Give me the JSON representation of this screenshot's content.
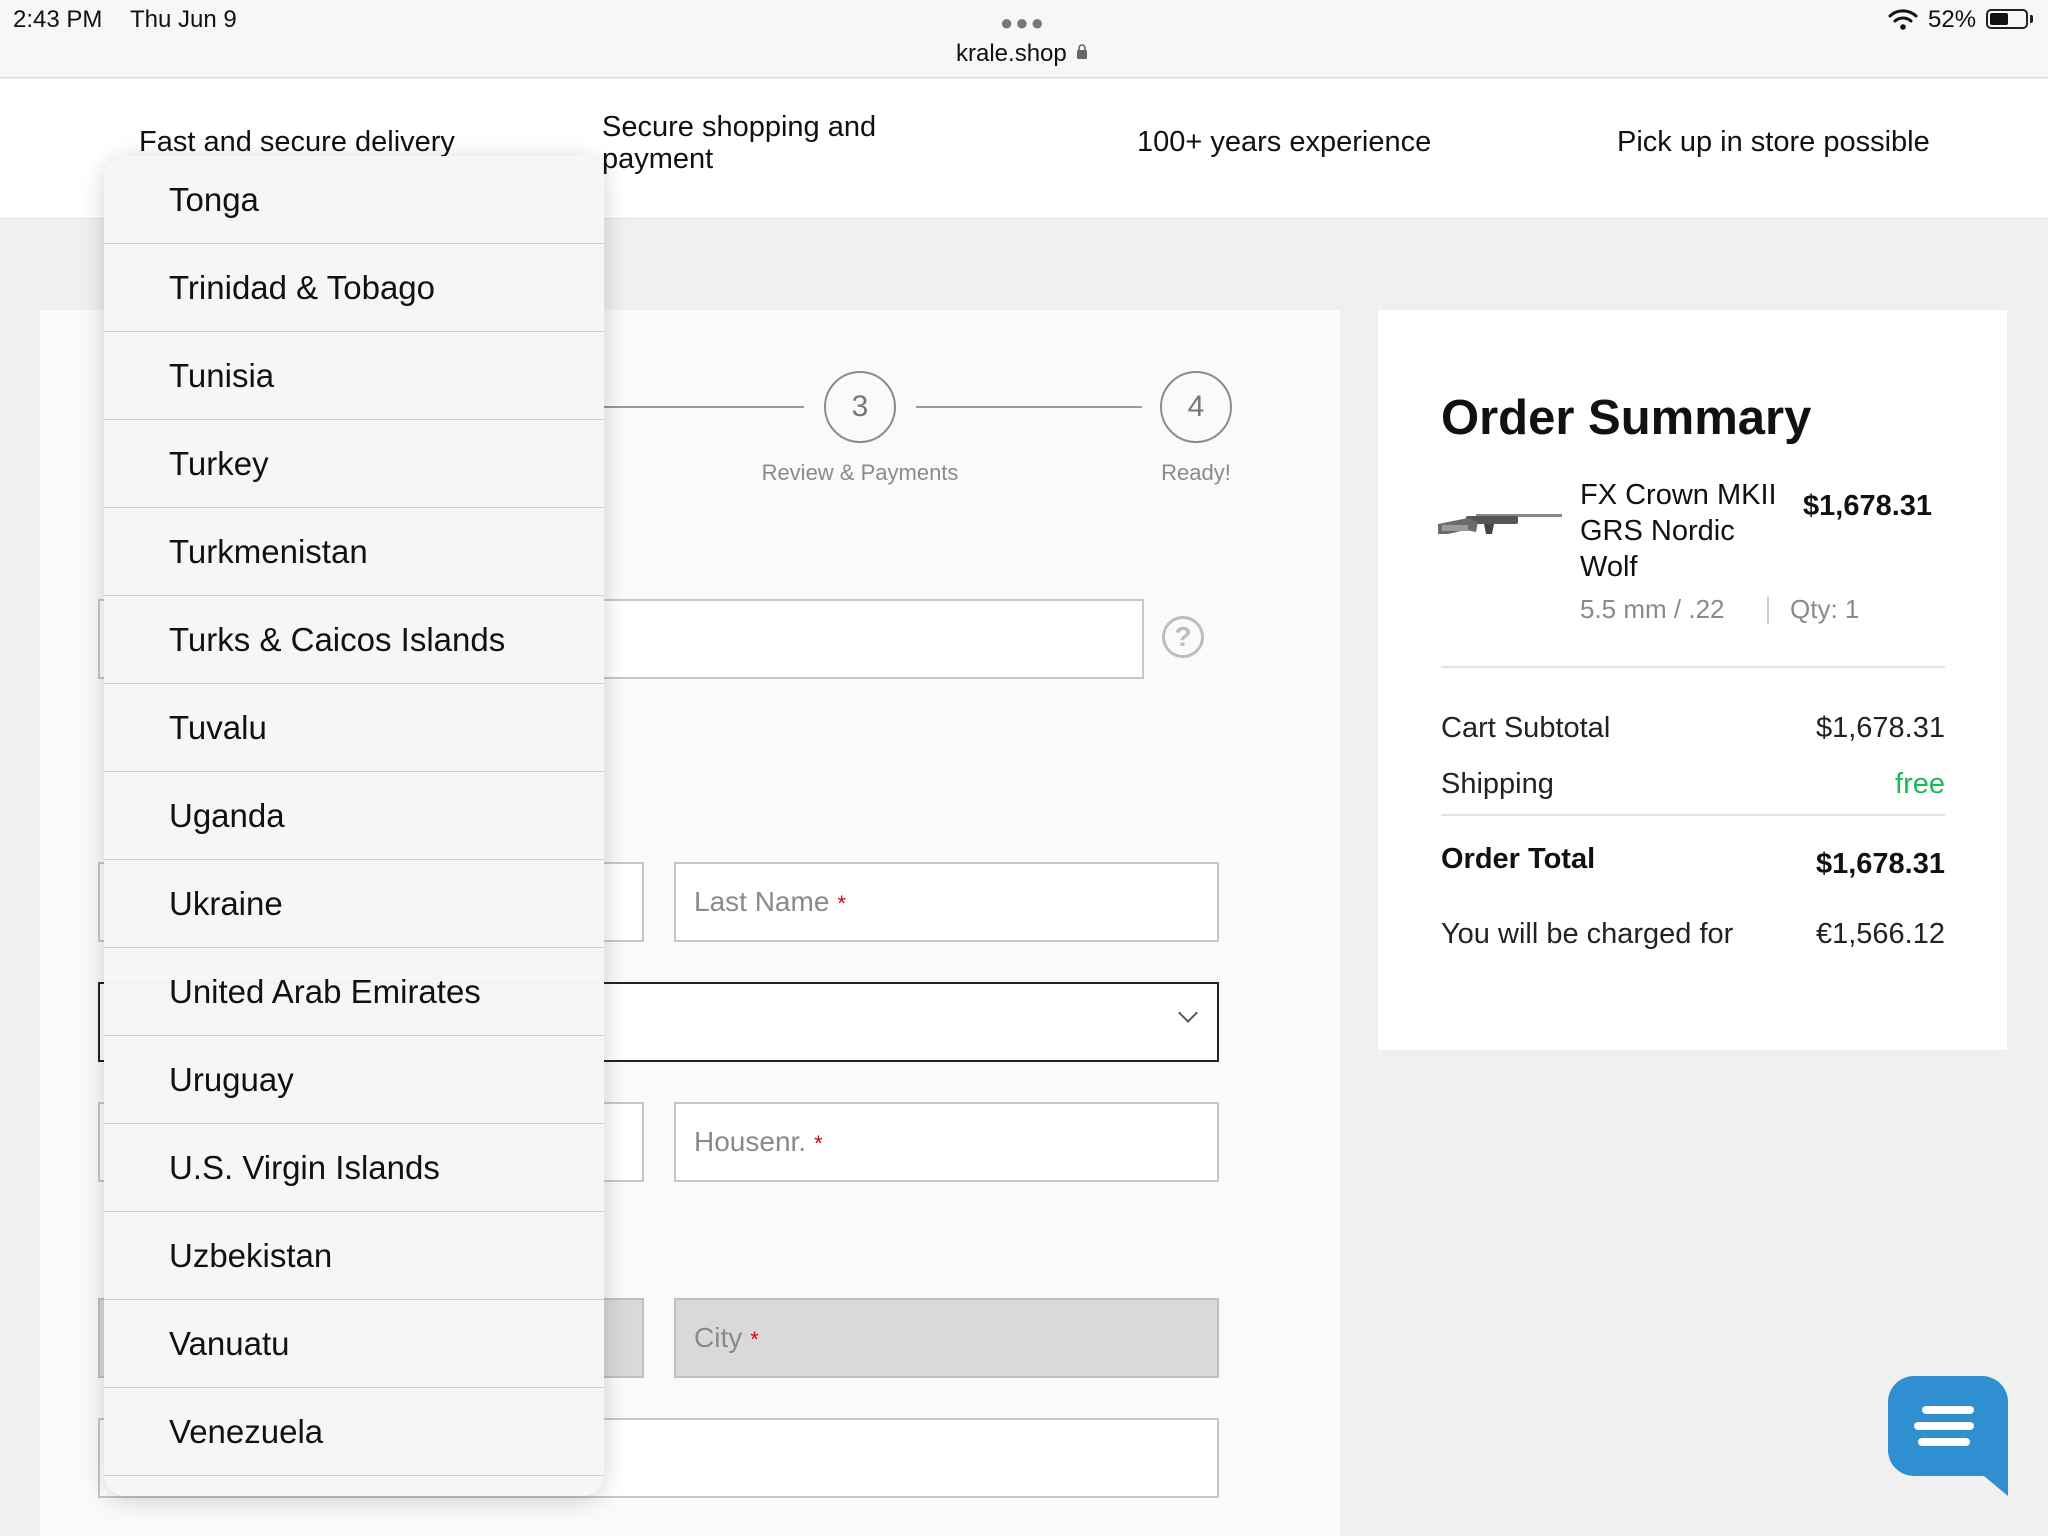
{
  "status_bar": {
    "time": "2:43 PM",
    "date": "Thu Jun 9",
    "url": "krale.shop",
    "battery": "52%",
    "battery_level": 0.52
  },
  "trust_bar": {
    "items": [
      {
        "label": "Fast and secure delivery"
      },
      {
        "label": "Secure shopping and payment"
      },
      {
        "label": "100+ years experience"
      },
      {
        "label": "Pick up in store possible"
      }
    ]
  },
  "steps": [
    {
      "number": "3",
      "label": "Review & Payments"
    },
    {
      "number": "4",
      "label": "Ready!"
    }
  ],
  "form": {
    "last_name": {
      "placeholder": "Last Name",
      "required": "*"
    },
    "housenr": {
      "placeholder": "Housenr.",
      "required": "*"
    },
    "city": {
      "placeholder": "City",
      "required": "*"
    },
    "help": "?"
  },
  "order_summary": {
    "title": "Order Summary",
    "product": {
      "name": "FX Crown MKII GRS Nordic Wolf",
      "price": "$1,678.31",
      "caliber": "5.5 mm / .22",
      "qty": "Qty: 1"
    },
    "rows": [
      {
        "label": "Cart Subtotal",
        "value": "$1,678.31"
      },
      {
        "label": "Shipping",
        "value": "free"
      },
      {
        "label": "Order Total",
        "value": "$1,678.31"
      },
      {
        "label": "You will be charged for",
        "value": "€1,566.12"
      }
    ]
  },
  "country_dropdown": {
    "options": [
      "Tonga",
      "Trinidad & Tobago",
      "Tunisia",
      "Turkey",
      "Turkmenistan",
      "Turks & Caicos Islands",
      "Tuvalu",
      "Uganda",
      "Ukraine",
      "United Arab Emirates",
      "Uruguay",
      "U.S. Virgin Islands",
      "Uzbekistan",
      "Vanuatu",
      "Venezuela"
    ]
  },
  "colors": {
    "accent_green": "#1db954",
    "chat_blue": "#2f8fd0",
    "required_red": "#d0021b"
  },
  "icons": [
    "lock-icon",
    "wifi-icon",
    "battery-icon",
    "help-icon",
    "chevron-down-icon",
    "chat-icon"
  ]
}
